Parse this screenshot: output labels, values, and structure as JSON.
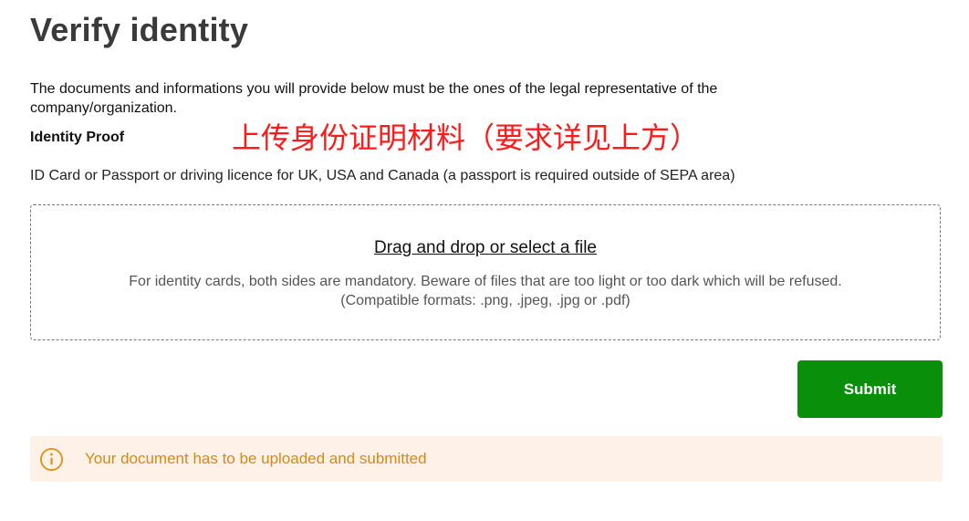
{
  "page": {
    "title": "Verify identity",
    "intro": "The documents and informations you will provide below must be the ones of the legal representative of the company/organization."
  },
  "identity_proof": {
    "label": "Identity Proof",
    "annotation": "上传身份证明材料（要求详见上方）",
    "accepted_documents": "ID Card or Passport or driving licence for UK, USA and Canada (a passport is required outside of SEPA area)"
  },
  "dropzone": {
    "link_label": "Drag and drop or select a file",
    "note_line1": "For identity cards, both sides are mandatory. Beware of files that are too light or too dark which will be refused.",
    "note_line2": "(Compatible formats: .png, .jpeg, .jpg or .pdf)"
  },
  "actions": {
    "submit_label": "Submit"
  },
  "notice": {
    "icon": "info-circle-icon",
    "text": "Your document has to be uploaded and submitted"
  },
  "colors": {
    "title": "#3a3a3a",
    "submit_bg": "#0a8f0a",
    "notice_bg": "#fdf1e8",
    "notice_text": "#d58a1a",
    "annotation": "#ff1a1a"
  }
}
